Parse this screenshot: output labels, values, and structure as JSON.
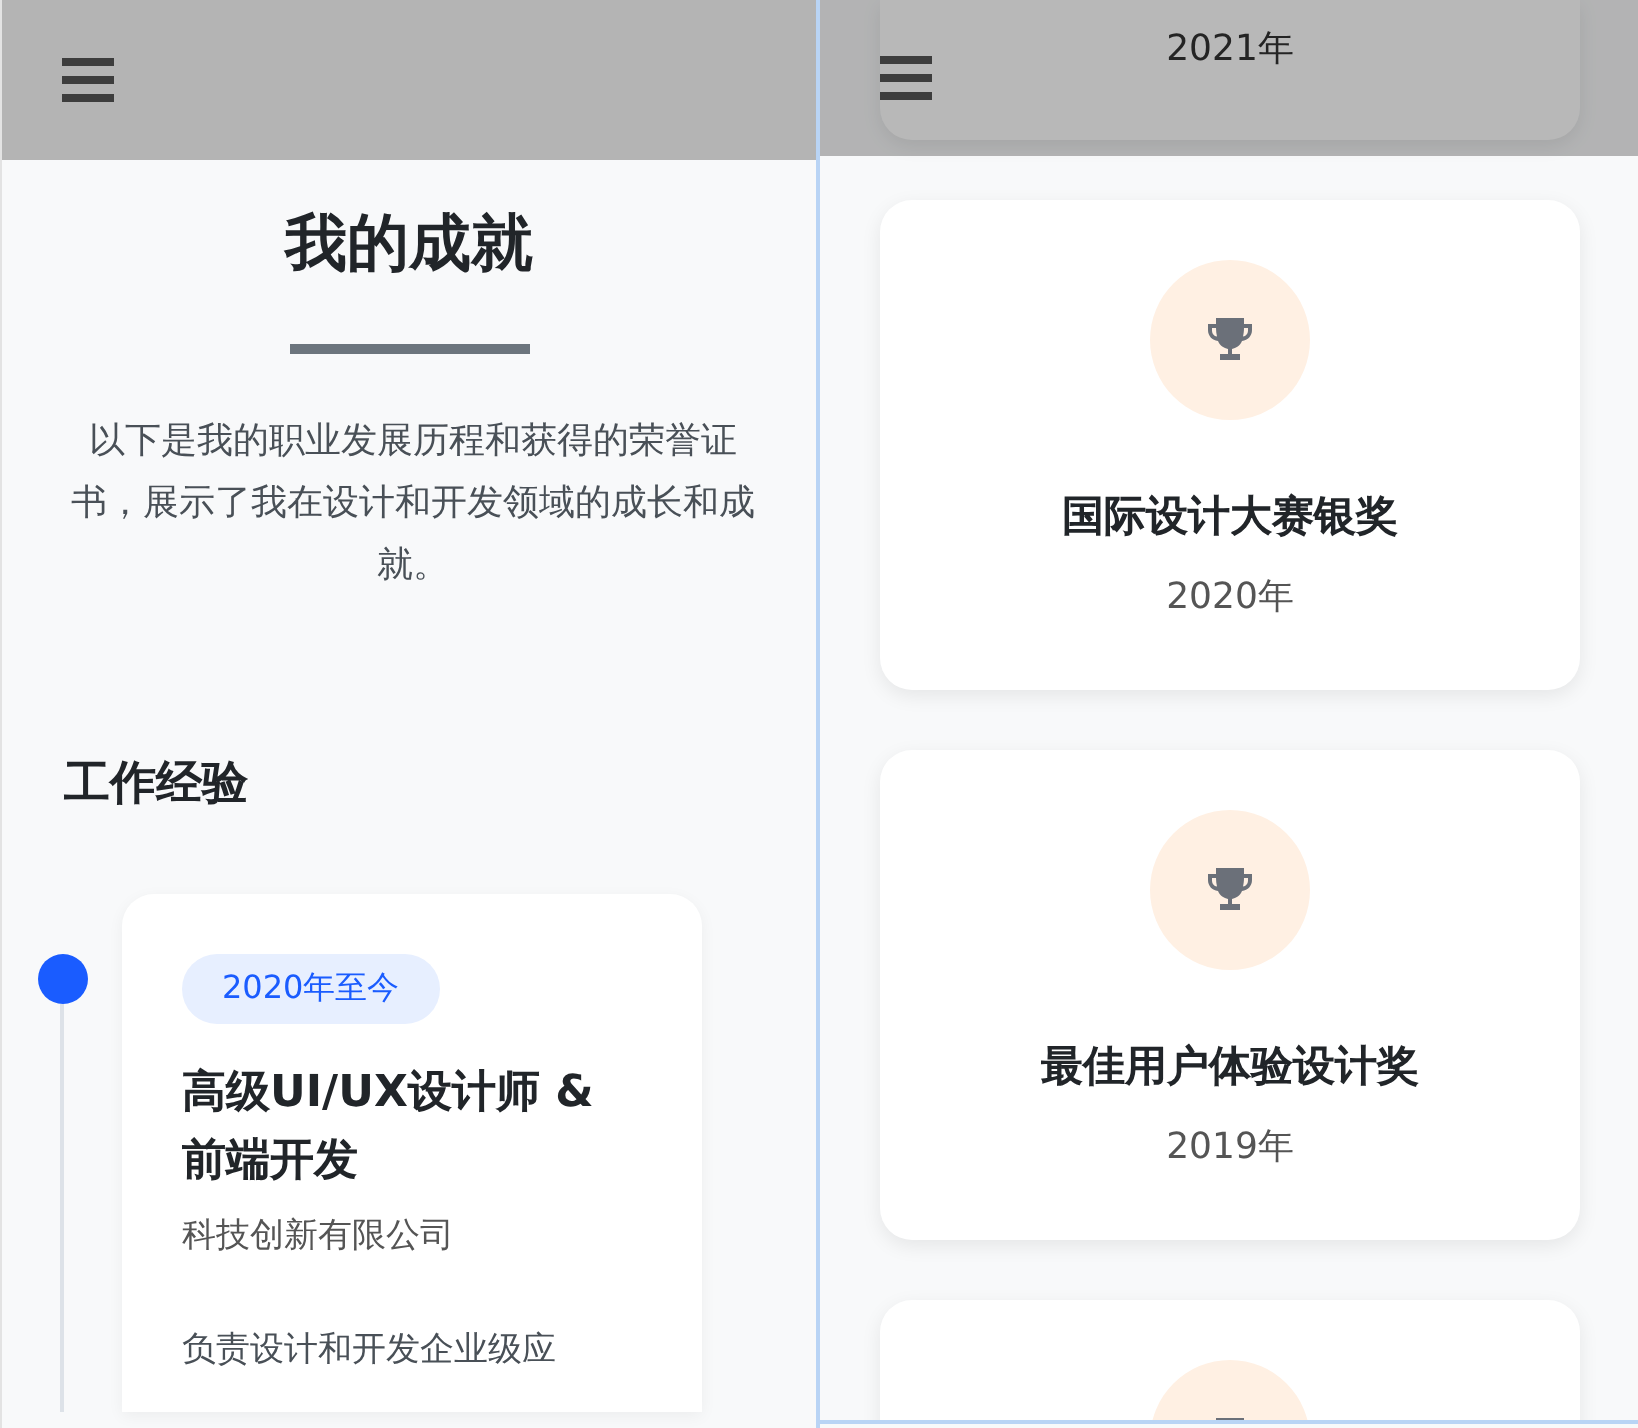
{
  "left": {
    "title": "我的成就",
    "intro": "以下是我的职业发展历程和获得的荣誉证书，展示了我在设计和开发领域的成长和成就。",
    "section": "工作经验",
    "timeline": [
      {
        "period": "2020年至今",
        "title": "高级UI/UX设计师 & 前端开发",
        "company": "科技创新有限公司",
        "description": "负责设计和开发企业级应"
      }
    ]
  },
  "right": {
    "awards": [
      {
        "kind": "date_only",
        "year": "2021年"
      },
      {
        "kind": "full",
        "title": "国际设计大赛银奖",
        "year": "2020年"
      },
      {
        "kind": "full",
        "title": "最佳用户体验设计奖",
        "year": "2019年"
      },
      {
        "kind": "icon_only"
      }
    ]
  }
}
